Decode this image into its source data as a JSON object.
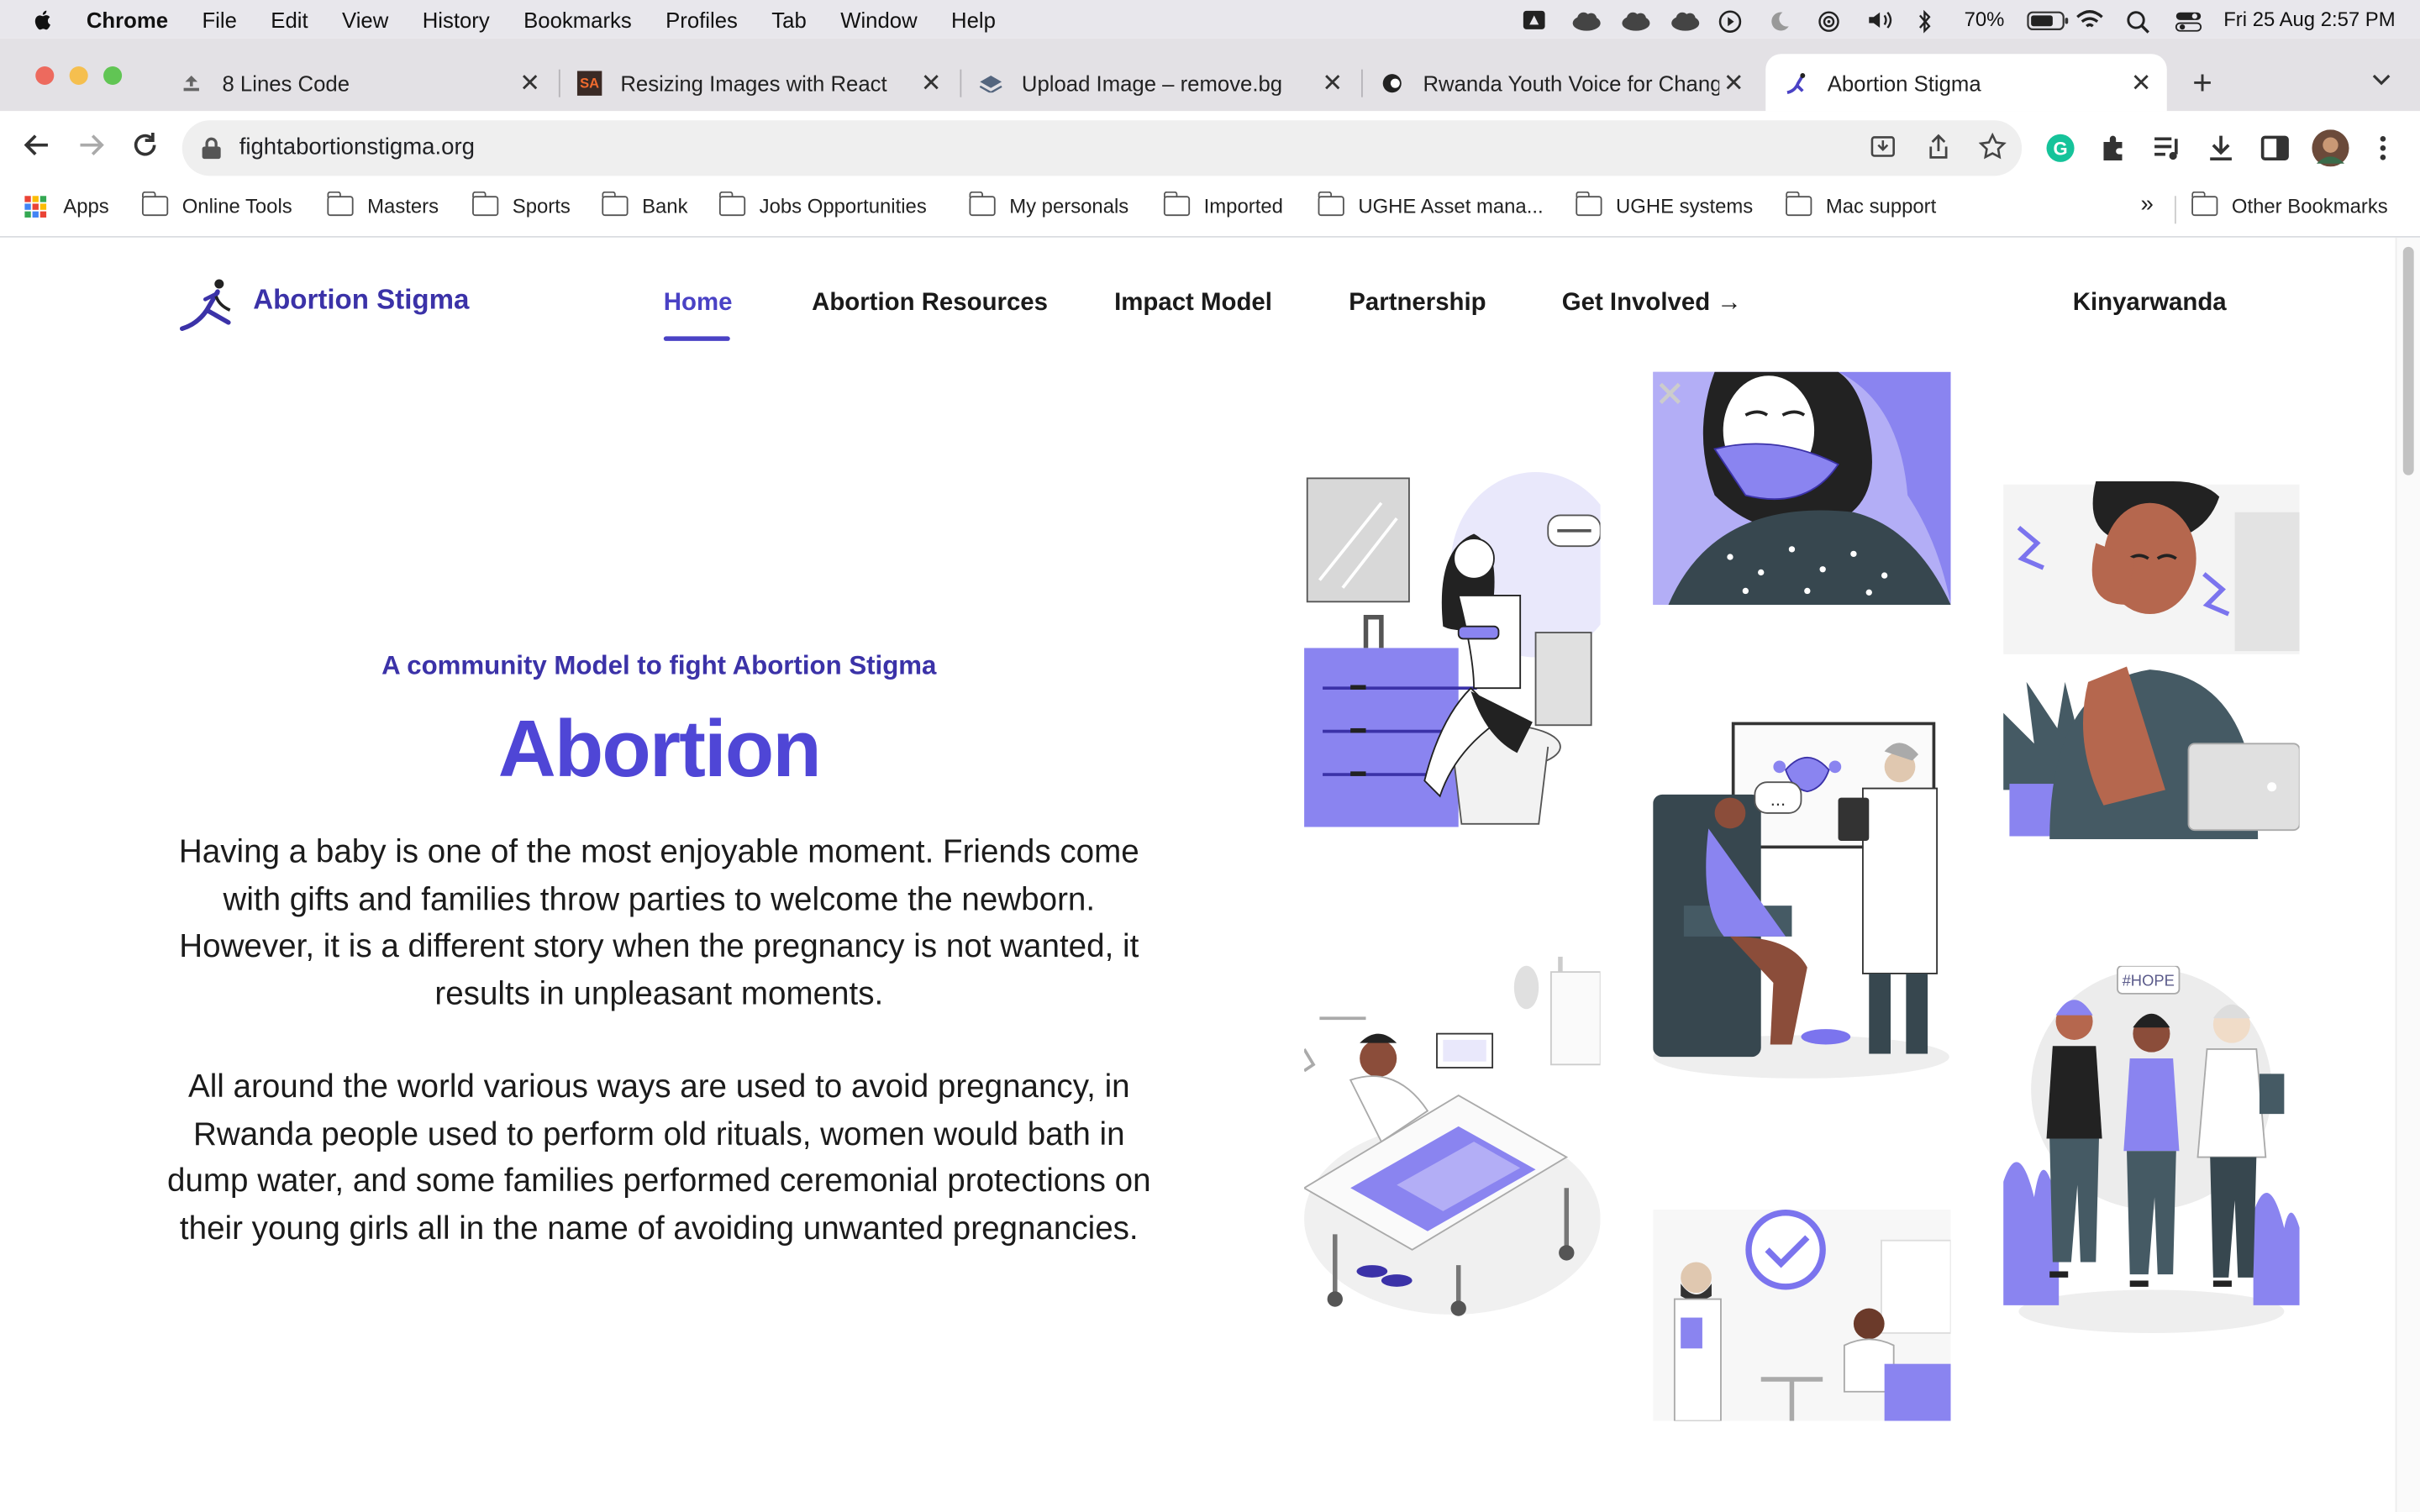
{
  "menubar": {
    "app": "Chrome",
    "items": [
      "File",
      "Edit",
      "View",
      "History",
      "Bookmarks",
      "Profiles",
      "Tab",
      "Window",
      "Help"
    ],
    "battery": "70%",
    "datetime": "Fri 25 Aug  2:57 PM"
  },
  "tabs": [
    {
      "title": "8 Lines Code",
      "favicon": "upload-icon"
    },
    {
      "title": "Resizing Images with React",
      "favicon": "sa-logo-icon"
    },
    {
      "title": "Upload Image – remove.bg",
      "favicon": "removebg-icon"
    },
    {
      "title": "Rwanda Youth Voice for Change",
      "favicon": "rwanda-youth-icon"
    },
    {
      "title": "Abortion Stigma",
      "favicon": "abortion-stigma-icon",
      "active": true
    }
  ],
  "toolbar": {
    "url": "fightabortionstigma.org"
  },
  "bookmarks": {
    "apps_label": "Apps",
    "items": [
      "Online Tools",
      "Masters",
      "Sports",
      "Bank",
      "Jobs Opportunities",
      "My personals",
      "Imported",
      "UGHE Asset mana...",
      "UGHE systems",
      "Mac support"
    ],
    "overflow": "»",
    "other": "Other Bookmarks"
  },
  "site": {
    "brand": "Abortion Stigma",
    "nav": {
      "home": "Home",
      "resources": "Abortion Resources",
      "impact": "Impact Model",
      "partnership": "Partnership",
      "involved": "Get Involved →",
      "language": "Kinyarwanda"
    },
    "hero": {
      "kicker": "A community Model to fight Abortion Stigma",
      "title": "Abortion",
      "paragraph1": "Having a baby is one of the most enjoyable moment. Friends come with gifts and families throw parties to welcome the newborn. However, it is a different story when the pregnancy is not wanted, it results in unpleasant moments.",
      "paragraph2": "All around the world various ways are used to avoid pregnancy, in Rwanda people used to perform old rituals, women would bath in dump water, and some families performed ceremonial protections on their young girls all in the name of avoiding unwanted pregnancies."
    },
    "illustrations": {
      "hope_tag": "#HOPE"
    }
  },
  "colors": {
    "accent": "#4f46d6",
    "brand": "#3b32a8",
    "illustration_purple": "#8a84f0"
  }
}
